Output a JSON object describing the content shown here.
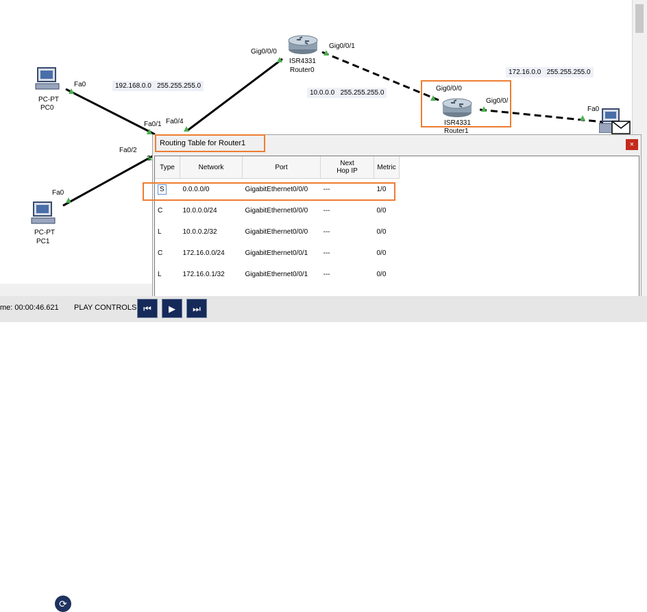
{
  "topology": {
    "devices": {
      "pc0": {
        "model": "PC-PT",
        "name": "PC0"
      },
      "pc1": {
        "model": "PC-PT",
        "name": "PC1"
      },
      "router0": {
        "model": "ISR4331",
        "name": "Router0"
      },
      "router1": {
        "model": "ISR4331",
        "name": "Router1"
      }
    },
    "interfaces": {
      "pc0_fa0": "Fa0",
      "pc1_fa0": "Fa0",
      "switch_fa0_1": "Fa0/1",
      "switch_fa0_4": "Fa0/4",
      "switch_fa0_2": "Fa0/2",
      "switch_partial": "2",
      "r0_gig000": "Gig0/0/0",
      "r0_gig001": "Gig0/0/1",
      "r1_gig000": "Gig0/0/0",
      "r1_gig001": "Gig0/0/",
      "pc2_fa0": "Fa0"
    },
    "networks": [
      {
        "ip": "192.168.0.0",
        "mask": "255.255.255.0"
      },
      {
        "ip": "10.0.0.0",
        "mask": "255.255.255.0"
      },
      {
        "ip": "172.16.0.0",
        "mask": "255.255.255.0"
      }
    ]
  },
  "routing_window": {
    "title": "Routing Table for Router1",
    "close_icon": "close-icon",
    "columns": {
      "type": "Type",
      "network": "Network",
      "port": "Port",
      "next_hop_1": "Next",
      "next_hop_2": "Hop IP",
      "metric": "Metric"
    },
    "rows": [
      {
        "type": "S",
        "network": "0.0.0.0/0",
        "port": "GigabitEthernet0/0/0",
        "next_hop": "---",
        "metric": "1/0"
      },
      {
        "type": "C",
        "network": "10.0.0.0/24",
        "port": "GigabitEthernet0/0/0",
        "next_hop": "---",
        "metric": "0/0"
      },
      {
        "type": "L",
        "network": "10.0.0.2/32",
        "port": "GigabitEthernet0/0/0",
        "next_hop": "---",
        "metric": "0/0"
      },
      {
        "type": "C",
        "network": "172.16.0.0/24",
        "port": "GigabitEthernet0/0/1",
        "next_hop": "---",
        "metric": "0/0"
      },
      {
        "type": "L",
        "network": "172.16.0.1/32",
        "port": "GigabitEthernet0/0/1",
        "next_hop": "---",
        "metric": "0/0"
      }
    ]
  },
  "statusbar": {
    "time_text": "me: 00:00:46.621",
    "play_controls_label": "PLAY CONTROLS:",
    "buttons": {
      "back": "⏮",
      "play": "▶",
      "forward": "⏭"
    }
  },
  "colors": {
    "highlight": "#ed7d31",
    "link_green": "#4caf50",
    "play_bg": "#152a59"
  }
}
